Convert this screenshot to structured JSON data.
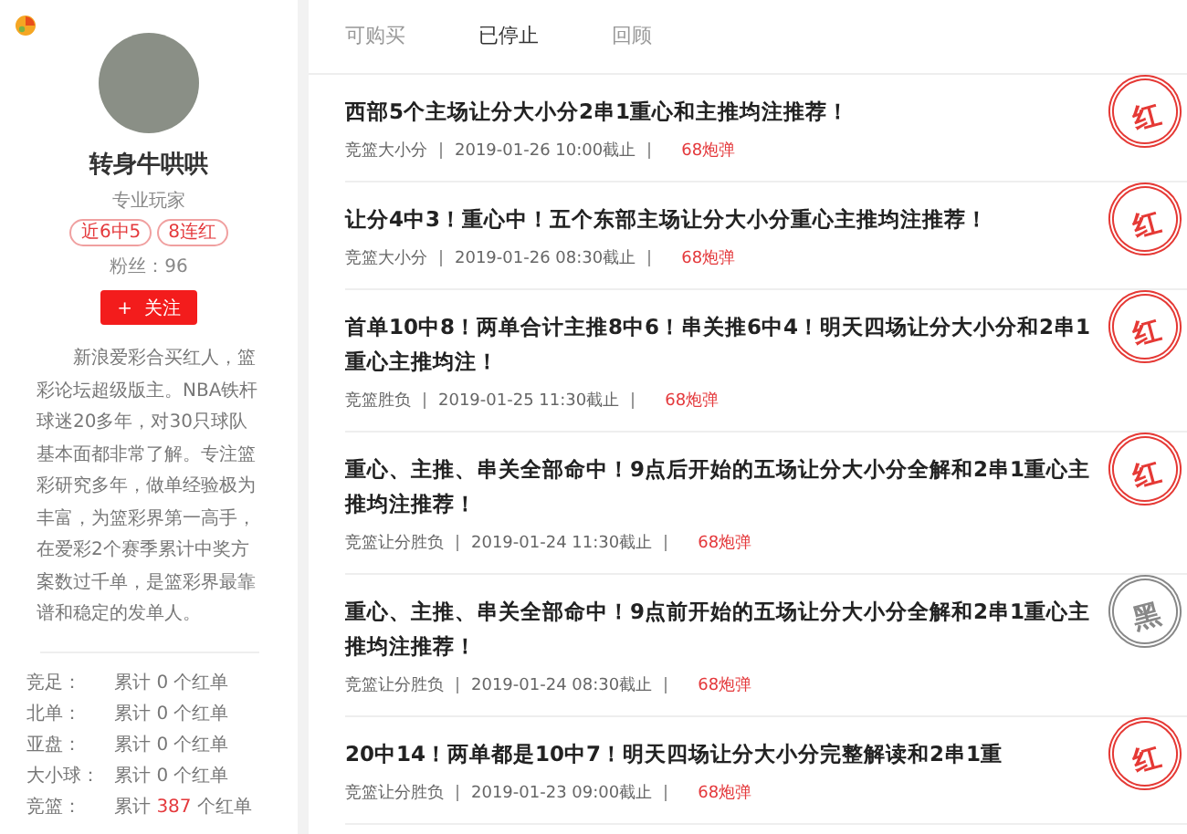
{
  "profile": {
    "name": "转身牛哄哄",
    "role": "专业玩家",
    "badges": [
      "近6中5",
      "8连红"
    ],
    "fans_label": "粉丝：",
    "fans": "96",
    "follow_button": {
      "icon": "+",
      "label": "关注"
    },
    "bio": "新浪爱彩合买红人，篮彩论坛超级版主。NBA铁杆球迷20多年，对30只球队基本面都非常了解。专注篮彩研究多年，做单经验极为丰富，为篮彩界第一高手，在爱彩2个赛季累计中奖方案数过千单，是篮彩界最靠谱和稳定的发单人。",
    "stats": [
      {
        "label": "竞足：",
        "prefix": "累计",
        "count": "0",
        "suffix": "个红单",
        "highlight": false
      },
      {
        "label": "北单：",
        "prefix": "累计",
        "count": "0",
        "suffix": "个红单",
        "highlight": false
      },
      {
        "label": "亚盘：",
        "prefix": "累计",
        "count": "0",
        "suffix": "个红单",
        "highlight": false
      },
      {
        "label": "大小球：",
        "prefix": "累计",
        "count": "0",
        "suffix": "个红单",
        "highlight": false
      },
      {
        "label": "竞篮：",
        "prefix": "累计",
        "count": "387",
        "suffix": "个红单",
        "highlight": true
      }
    ]
  },
  "tabs": [
    {
      "label": "可购买",
      "selected": false
    },
    {
      "label": "已停止",
      "selected": true
    },
    {
      "label": "回顾",
      "selected": false
    }
  ],
  "posts": [
    {
      "title": "西部5个主场让分大小分2串1重心和主推均注推荐！",
      "category": "竞篮大小分",
      "deadline": "2019-01-26 10:00截止",
      "price": "68炮弹",
      "stamp": {
        "kind": "red",
        "text": "红"
      }
    },
    {
      "title": "让分4中3！重心中！五个东部主场让分大小分重心主推均注推荐！",
      "category": "竞篮大小分",
      "deadline": "2019-01-26 08:30截止",
      "price": "68炮弹",
      "stamp": {
        "kind": "red",
        "text": "红"
      }
    },
    {
      "title": "首单10中8！两单合计主推8中6！串关推6中4！明天四场让分大小分和2串1重心主推均注！",
      "category": "竞篮胜负",
      "deadline": "2019-01-25 11:30截止",
      "price": "68炮弹",
      "stamp": {
        "kind": "red",
        "text": "红"
      }
    },
    {
      "title": "重心、主推、串关全部命中！9点后开始的五场让分大小分全解和2串1重心主推均注推荐！",
      "category": "竞篮让分胜负",
      "deadline": "2019-01-24 11:30截止",
      "price": "68炮弹",
      "stamp": {
        "kind": "red",
        "text": "红"
      }
    },
    {
      "title": "重心、主推、串关全部命中！9点前开始的五场让分大小分全解和2串1重心主推均注推荐！",
      "category": "竞篮让分胜负",
      "deadline": "2019-01-24 08:30截止",
      "price": "68炮弹",
      "stamp": {
        "kind": "black",
        "text": "黑"
      }
    },
    {
      "title": "20中14！两单都是10中7！明天四场让分大小分完整解读和2串1重",
      "category": "竞篮让分胜负",
      "deadline": "2019-01-23 09:00截止",
      "price": "68炮弹",
      "stamp": {
        "kind": "red",
        "text": "红"
      }
    }
  ]
}
